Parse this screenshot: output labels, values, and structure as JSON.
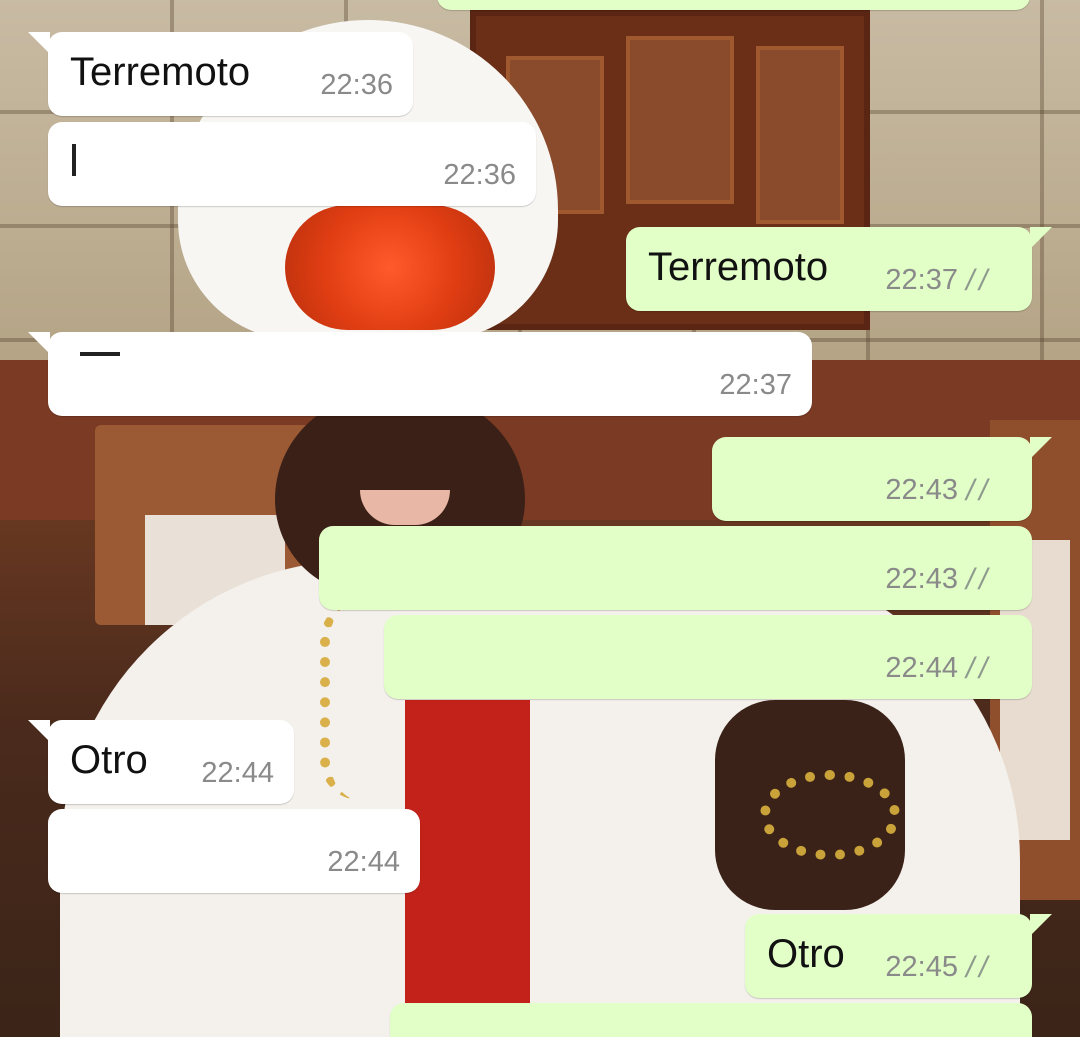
{
  "messages": [
    {
      "direction": "in",
      "text": "",
      "time": ""
    },
    {
      "direction": "in",
      "text": "Terremoto",
      "time": "22:36"
    },
    {
      "direction": "in",
      "text": "",
      "time": "22:36"
    },
    {
      "direction": "out",
      "text": "Terremoto",
      "time": "22:37"
    },
    {
      "direction": "in",
      "text": "",
      "time": "22:37"
    },
    {
      "direction": "out",
      "text": "",
      "time": "22:43"
    },
    {
      "direction": "out",
      "text": "",
      "time": "22:43"
    },
    {
      "direction": "out",
      "text": "",
      "time": "22:44"
    },
    {
      "direction": "in",
      "text": "Otro",
      "time": "22:44"
    },
    {
      "direction": "in",
      "text": "",
      "time": "22:44"
    },
    {
      "direction": "out",
      "text": "Otro",
      "time": "22:45"
    },
    {
      "direction": "out",
      "text": "",
      "time": ""
    }
  ],
  "colors": {
    "incoming_bubble": "#ffffff",
    "outgoing_bubble": "#e1ffc7",
    "time_text": "#8a8a8a",
    "read_ticks": "#8f9a8f"
  },
  "icons": {
    "delivered": "double-check-icon"
  }
}
